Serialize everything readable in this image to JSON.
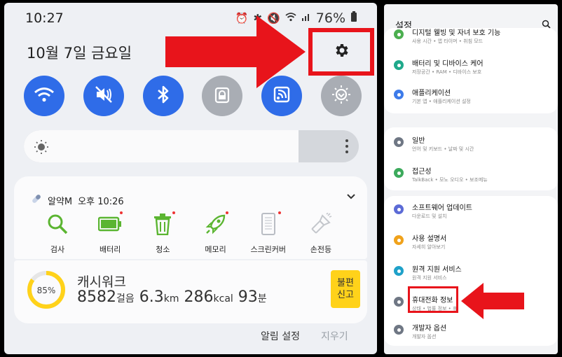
{
  "left": {
    "status": {
      "time": "10:27",
      "battery": "76%"
    },
    "date": "10월 7일 금요일",
    "quick_toggles": [
      {
        "name": "wifi-icon",
        "on": true
      },
      {
        "name": "mute-icon",
        "on": true
      },
      {
        "name": "bluetooth-icon",
        "on": true
      },
      {
        "name": "lock-icon",
        "on": false
      },
      {
        "name": "cast-icon",
        "on": true
      },
      {
        "name": "eye-comfort-icon",
        "on": false
      }
    ],
    "notification": {
      "app": "알약M",
      "time": "오후 10:26",
      "actions": [
        "검사",
        "배터리",
        "청소",
        "메모리",
        "스크린커버",
        "손전등"
      ]
    },
    "cashwalk": {
      "title": "캐시워크",
      "percent": "85%",
      "progress": 0.85,
      "steps": "8582",
      "steps_unit": "걸음",
      "distance": "6.3",
      "distance_unit": "km",
      "kcal": "286",
      "kcal_unit": "kcal",
      "minutes": "93",
      "minutes_unit": "분",
      "report_line1": "불편",
      "report_line2": "신고"
    },
    "footer": {
      "settings": "알림 설정",
      "clear": "지우기"
    }
  },
  "right": {
    "title": "설정",
    "groups": [
      [
        {
          "title": "디지털 웰빙 및 자녀 보호 기능",
          "sub": "사용 시간  •  앱 타이머  •  취침 모드",
          "color": "#4caf50",
          "icon": "wellbeing-icon"
        },
        {
          "title": "배터리 및 디바이스 케어",
          "sub": "저장공간  •  RAM  •  디바이스 보호",
          "color": "#1fa98b",
          "icon": "device-care-icon"
        },
        {
          "title": "애플리케이션",
          "sub": "기본 앱  •  애플리케이션 설정",
          "color": "#3d7bea",
          "icon": "apps-icon"
        }
      ],
      [
        {
          "title": "일반",
          "sub": "언어 및 키보드  •  날짜 및 시간",
          "color": "#6f7784",
          "icon": "general-icon"
        },
        {
          "title": "접근성",
          "sub": "TalkBack  •  모노 오디오  •  보조메뉴",
          "color": "#3caa5c",
          "icon": "accessibility-icon"
        }
      ],
      [
        {
          "title": "소프트웨어 업데이트",
          "sub": "다운로드 및 설치",
          "color": "#5c6bd6",
          "icon": "update-icon"
        },
        {
          "title": "사용 설명서",
          "sub": "자세히 알아보기",
          "color": "#f0a21b",
          "icon": "manual-icon"
        },
        {
          "title": "원격 지원 서비스",
          "sub": "원격 지원 서비스",
          "color": "#1fa1c9",
          "icon": "remote-icon"
        },
        {
          "title": "휴대전화 정보",
          "sub": "상태  •  법률 정보  •  휴",
          "color": "#6f7784",
          "icon": "info-icon"
        },
        {
          "title": "개발자 옵션",
          "sub": "개발자 옵션",
          "color": "#6f7784",
          "icon": "developer-icon"
        }
      ]
    ]
  },
  "colors": {
    "annotation_red": "#e8141b",
    "toggle_on": "#2f6ce8",
    "toggle_off": "#a9adb4",
    "ring_yellow": "#ffd21a"
  }
}
